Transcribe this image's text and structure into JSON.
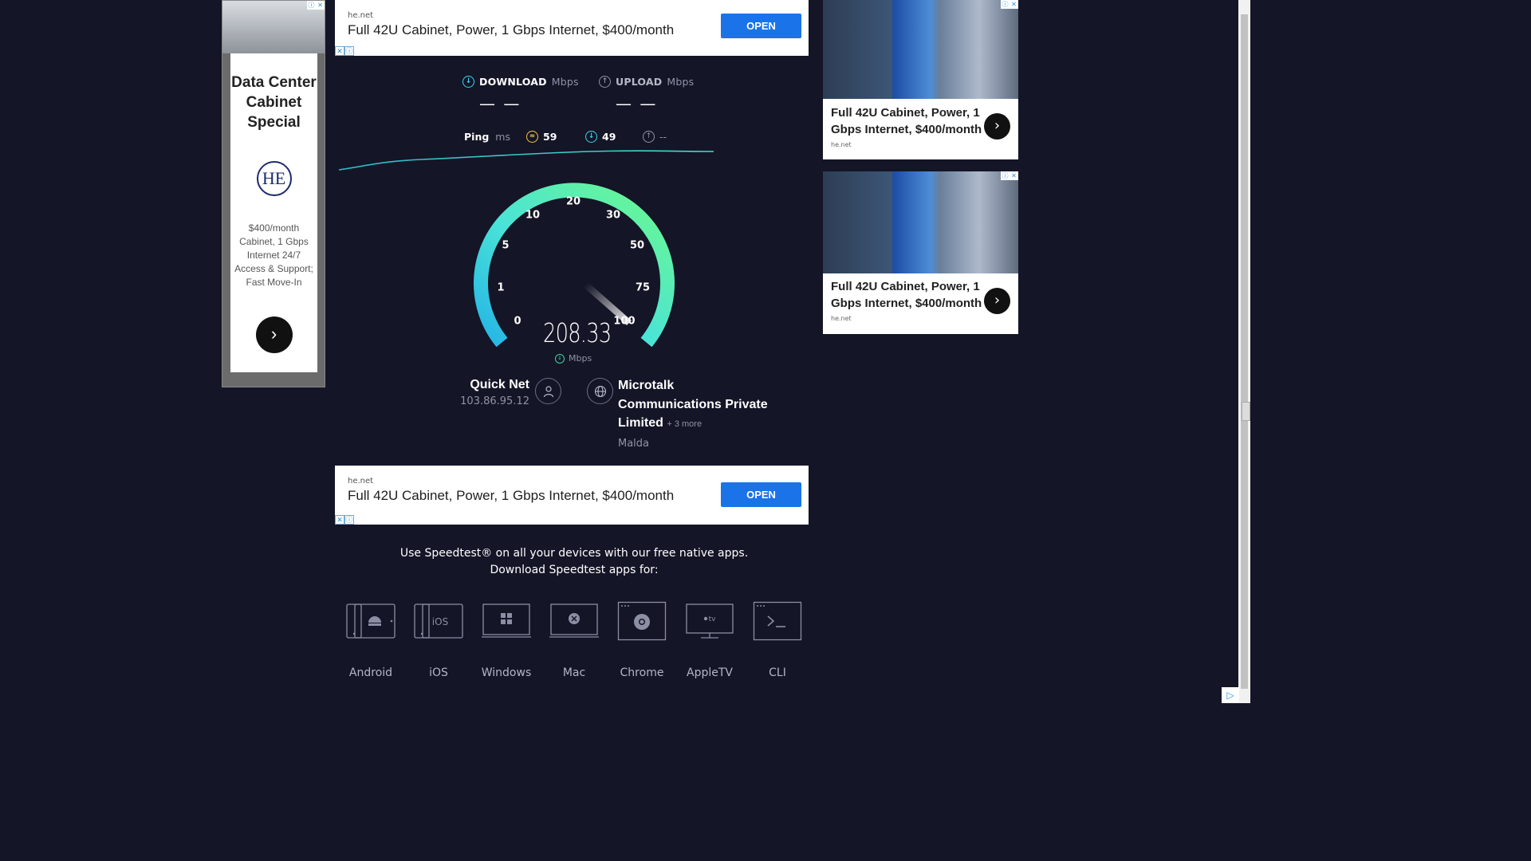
{
  "top_banner": {
    "domain": "he.net",
    "headline": "Full 42U Cabinet, Power, 1 Gbps Internet, $400/month",
    "button": "OPEN"
  },
  "bottom_banner": {
    "domain": "he.net",
    "headline": "Full 42U Cabinet, Power, 1 Gbps Internet, $400/month",
    "button": "OPEN"
  },
  "left_ad": {
    "title": "Data Center Cabinet Special",
    "logo": "HE",
    "desc": "$400/month Cabinet, 1 Gbps Internet 24/7 Access & Support; Fast Move-In"
  },
  "right_ads": [
    {
      "headline": "Full 42U Cabinet, Power, 1 Gbps Internet, $400/month",
      "source": "he.net"
    },
    {
      "headline": "Full 42U Cabinet, Power, 1 Gbps Internet, $400/month",
      "source": "he.net"
    }
  ],
  "speedtest": {
    "download_label": "DOWNLOAD",
    "upload_label": "UPLOAD",
    "unit": "Mbps",
    "download_value": "— —",
    "upload_value": "— —",
    "ping_label": "Ping",
    "ping_unit": "ms",
    "ping_idle": "59",
    "ping_download": "49",
    "ping_upload": "--",
    "gauge_ticks": [
      "0",
      "1",
      "5",
      "10",
      "20",
      "30",
      "50",
      "75",
      "100"
    ],
    "current_speed": "208.33",
    "current_unit": "Mbps",
    "accent_color": "#3ad4f0",
    "accent_color_end": "#6cf98c"
  },
  "connection": {
    "isp": "Quick Net",
    "ip": "103.86.95.12",
    "server": "Microtalk Communications Private Limited",
    "server_more": "+ 3 more",
    "city": "Malda"
  },
  "apps": {
    "line1": "Use Speedtest® on all your devices with our free native apps.",
    "line2": "Download Speedtest apps for:",
    "items": [
      {
        "name": "Android",
        "icon": "android-icon"
      },
      {
        "name": "iOS",
        "icon": "ios-icon"
      },
      {
        "name": "Windows",
        "icon": "windows-icon"
      },
      {
        "name": "Mac",
        "icon": "mac-icon"
      },
      {
        "name": "Chrome",
        "icon": "chrome-icon"
      },
      {
        "name": "AppleTV",
        "icon": "appletv-icon"
      },
      {
        "name": "CLI",
        "icon": "cli-icon"
      }
    ],
    "ios_icon_text": "iOS",
    "appletv_icon_text": "tv"
  }
}
